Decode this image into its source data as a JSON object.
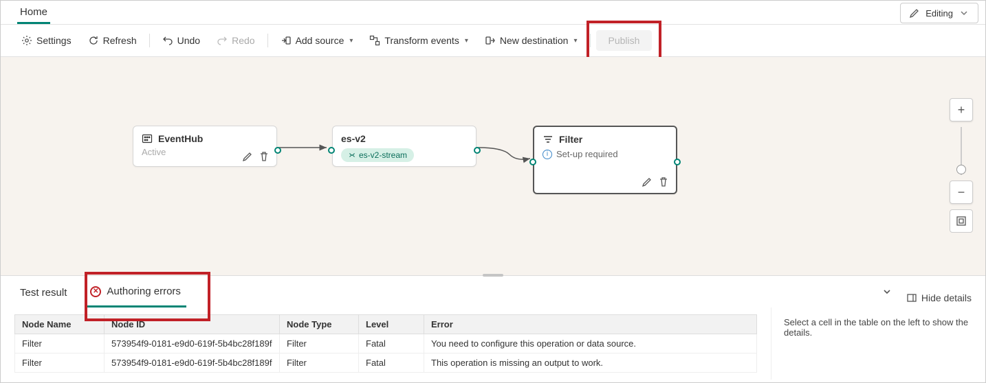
{
  "header": {
    "tab_home": "Home",
    "editing_label": "Editing"
  },
  "toolbar": {
    "settings": "Settings",
    "refresh": "Refresh",
    "undo": "Undo",
    "redo": "Redo",
    "add_source": "Add source",
    "transform_events": "Transform events",
    "new_destination": "New destination",
    "publish": "Publish"
  },
  "nodes": {
    "eventhub": {
      "title": "EventHub",
      "status": "Active"
    },
    "esv2": {
      "title": "es-v2",
      "chip": "es-v2-stream"
    },
    "filter": {
      "title": "Filter",
      "status": "Set-up required"
    }
  },
  "panel": {
    "tabs": {
      "test_result": "Test result",
      "authoring_errors": "Authoring errors"
    },
    "hide_details": "Hide details",
    "details_placeholder": "Select a cell in the table on the left to show the details.",
    "columns": {
      "node_name": "Node Name",
      "node_id": "Node ID",
      "node_type": "Node Type",
      "level": "Level",
      "error": "Error"
    },
    "rows": [
      {
        "node_name": "Filter",
        "node_id": "573954f9-0181-e9d0-619f-5b4bc28f189f",
        "node_type": "Filter",
        "level": "Fatal",
        "error": "You need to configure this operation or data source."
      },
      {
        "node_name": "Filter",
        "node_id": "573954f9-0181-e9d0-619f-5b4bc28f189f",
        "node_type": "Filter",
        "level": "Fatal",
        "error": "This operation is missing an output to work."
      }
    ]
  }
}
